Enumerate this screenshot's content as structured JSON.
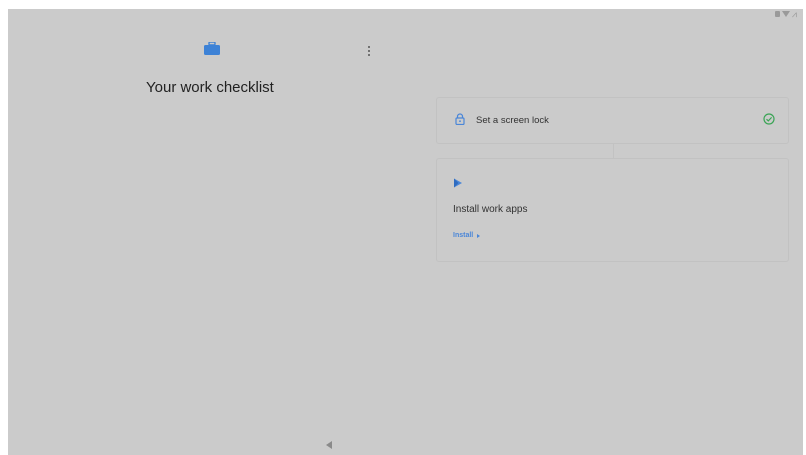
{
  "app": {
    "title": "Your work checklist",
    "icons": {
      "header": "briefcase-icon",
      "menu": "overflow-menu-icon",
      "back": "back-icon"
    },
    "colors": {
      "accent": "#4a86d8",
      "success": "#3aa455",
      "background": "#cbcbcb"
    }
  },
  "status_bar": {
    "icons": [
      "battery-icon",
      "wifi-icon",
      "signal-icon"
    ]
  },
  "checklist": {
    "items": [
      {
        "label": "Set a screen lock",
        "icon": "lock-icon",
        "status": "complete",
        "status_icon": "check-circle-icon"
      },
      {
        "label": "Install work apps",
        "icon": "play-store-icon",
        "action_label": "Install"
      }
    ]
  }
}
